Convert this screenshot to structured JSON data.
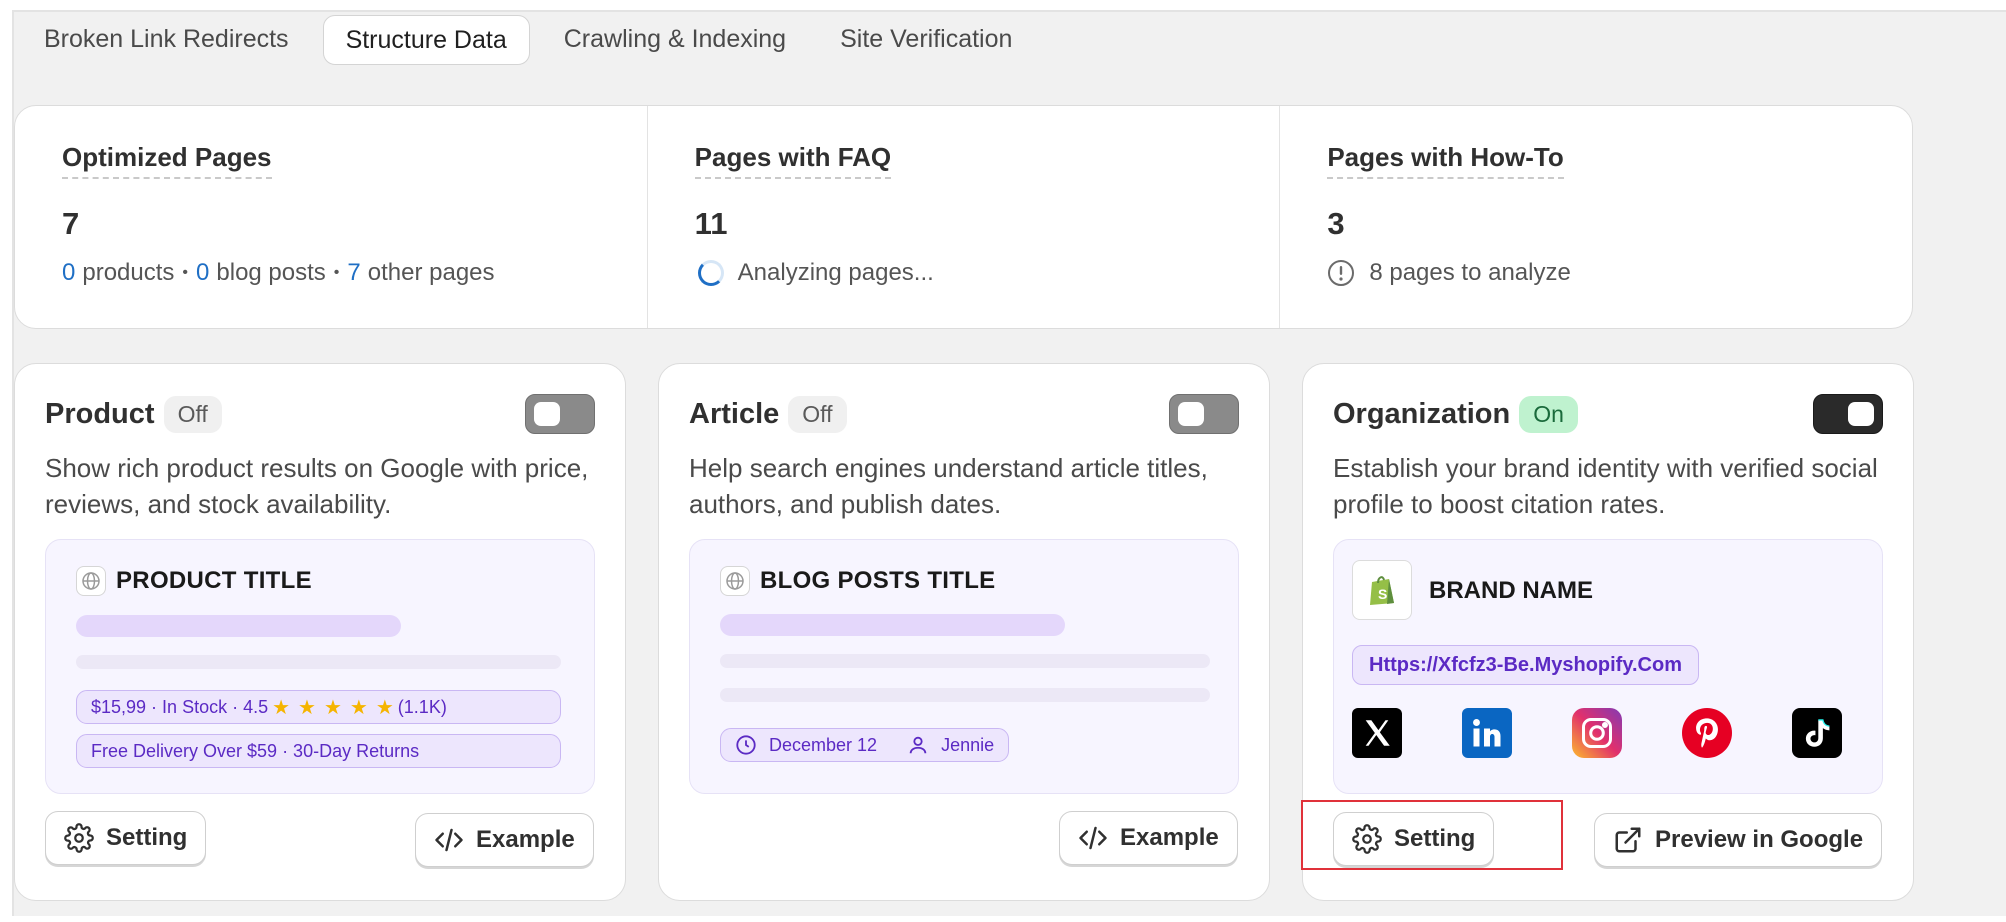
{
  "tabs": [
    {
      "label": "Broken Link Redirects",
      "active": false
    },
    {
      "label": "Structure Data",
      "active": true
    },
    {
      "label": "Crawling & Indexing",
      "active": false
    },
    {
      "label": "Site Verification",
      "active": false
    }
  ],
  "stats": {
    "optimized": {
      "title": "Optimized Pages",
      "value": "7",
      "products_count": "0",
      "products_label": "products",
      "blog_count": "0",
      "blog_label": "blog posts",
      "other_count": "7",
      "other_label": "other pages",
      "separator": "•"
    },
    "faq": {
      "title": "Pages with FAQ",
      "value": "11",
      "status": "Analyzing pages..."
    },
    "howto": {
      "title": "Pages with How-To",
      "value": "3",
      "status": "8 pages to analyze"
    }
  },
  "cards": {
    "product": {
      "name": "Product",
      "badge": "Off",
      "enabled": false,
      "description": "Show rich product results on Google with price, reviews, and stock availability.",
      "preview_title": "PRODUCT TITLE",
      "price_text": "$15,99 · In Stock · 4.5",
      "rating_stars": 5,
      "star_glyph": "★",
      "review_count": "(1.1K)",
      "delivery_text": "Free Delivery Over $59 · 30-Day Returns",
      "setting_label": "Setting",
      "example_label": "Example"
    },
    "article": {
      "name": "Article",
      "badge": "Off",
      "enabled": false,
      "description": "Help search engines understand article titles, authors, and publish dates.",
      "preview_title": "BLOG POSTS TITLE",
      "date": "December 12",
      "author": "Jennie",
      "example_label": "Example"
    },
    "organization": {
      "name": "Organization",
      "badge": "On",
      "enabled": true,
      "description": "Establish your brand identity with verified social profile to boost citation rates.",
      "brand_name": "BRAND NAME",
      "url": "Https://Xfcfz3-Be.Myshopify.Com",
      "socials": [
        "x-icon",
        "linkedin-icon",
        "instagram-icon",
        "pinterest-icon",
        "tiktok-icon"
      ],
      "setting_label": "Setting",
      "preview_label": "Preview in Google"
    }
  },
  "colors": {
    "accent_blue": "#1f6fc5",
    "purple_text": "#5b2ac4",
    "on_badge": "#bff2cf",
    "highlight_box": "#e0313a"
  }
}
